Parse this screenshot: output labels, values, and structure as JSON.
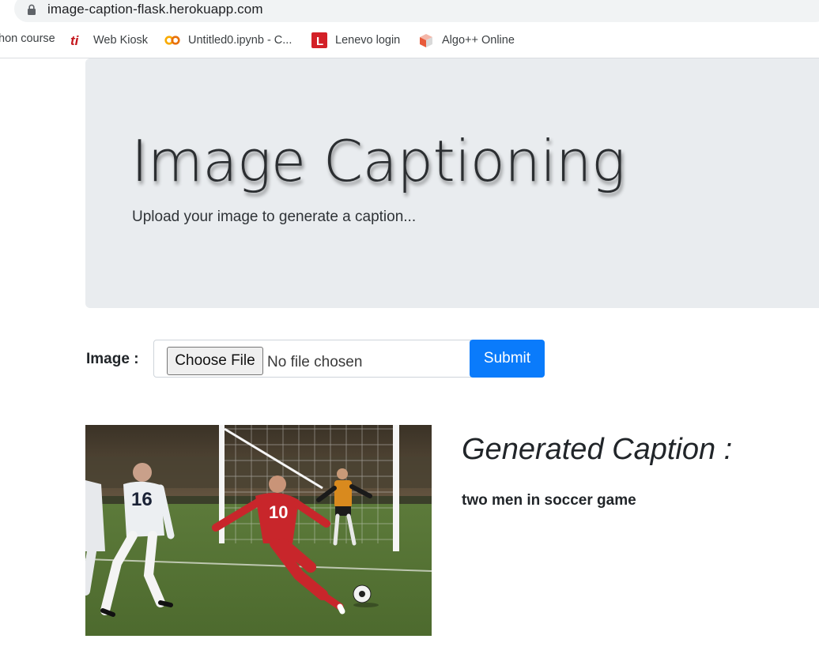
{
  "browser": {
    "url": "image-caption-flask.herokuapp.com",
    "bookmarks": [
      {
        "label": "hon course",
        "icon": "none"
      },
      {
        "label": "Web Kiosk",
        "icon": "ti-logo-icon"
      },
      {
        "label": "Untitled0.ipynb - C...",
        "icon": "colab-icon"
      },
      {
        "label": "Lenevo login",
        "icon": "l-logo-icon"
      },
      {
        "label": "Algo++ Online",
        "icon": "cube-icon"
      }
    ]
  },
  "hero": {
    "title": "Image Captioning",
    "subtitle": "Upload your image to generate a caption..."
  },
  "form": {
    "label": "Image :",
    "choose_file": "Choose File",
    "no_file": "No file chosen",
    "submit": "Submit"
  },
  "result": {
    "heading": "Generated Caption :",
    "caption": "two men in soccer game",
    "photo_numbers": [
      "16",
      "10"
    ]
  },
  "colors": {
    "jumbotron": "#e9ecef",
    "primary": "#0a7bfb",
    "grass": "#5f7f3a",
    "red_jersey": "#c8262b"
  }
}
